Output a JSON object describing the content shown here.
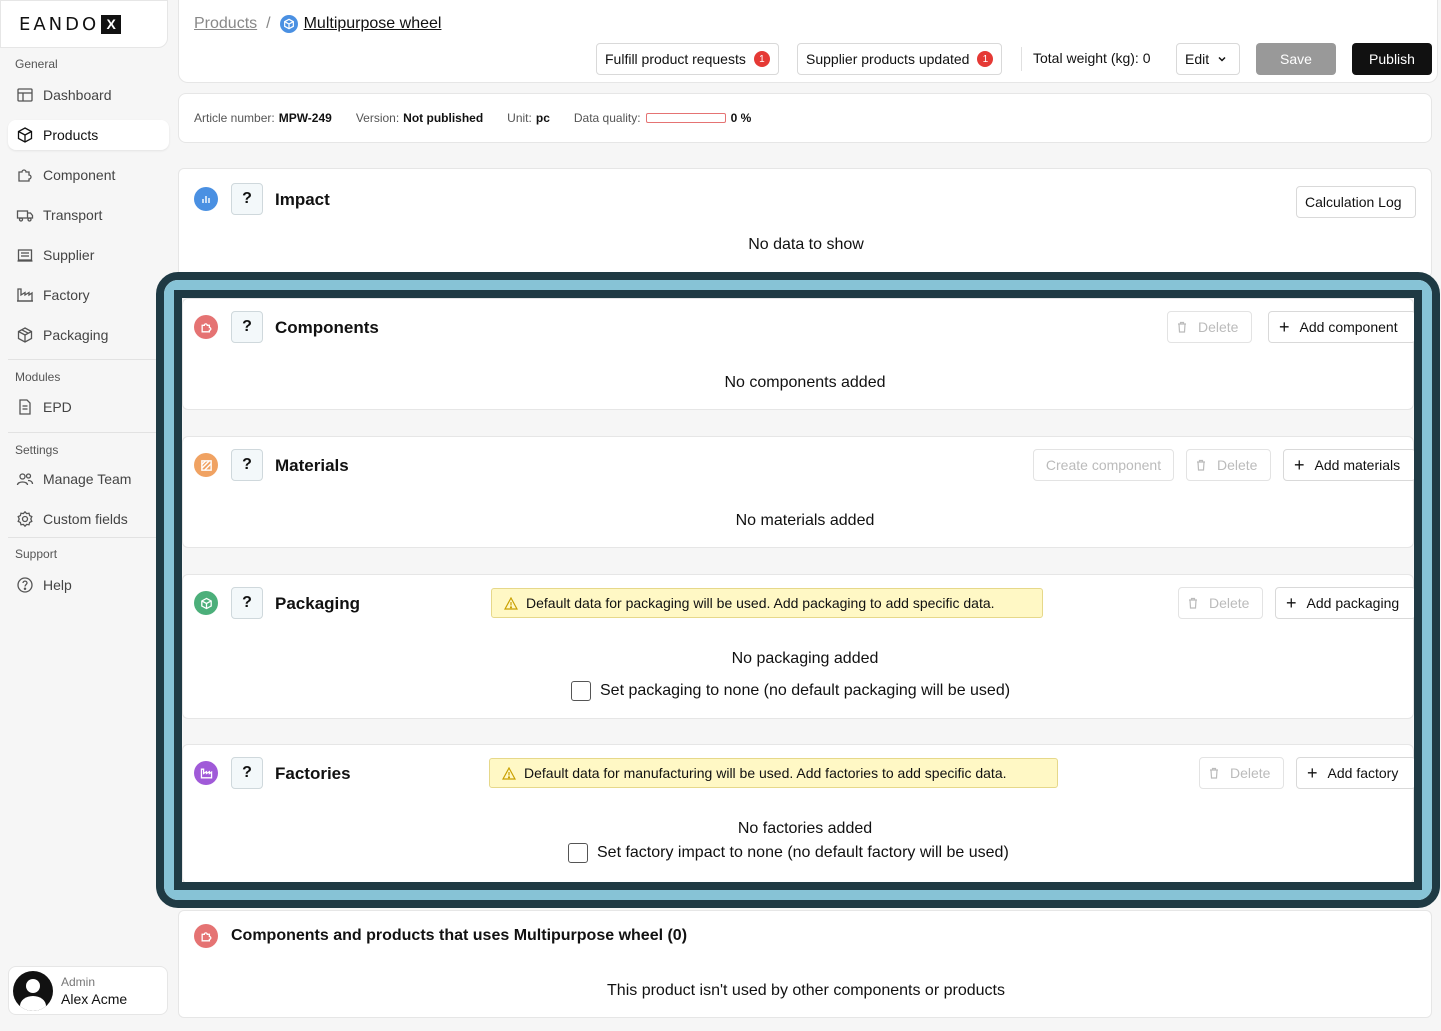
{
  "sidebar": {
    "logo": "EANDO",
    "logo_mark": "X",
    "sections": {
      "general": "General",
      "modules": "Modules",
      "settings": "Settings",
      "support": "Support"
    },
    "items": {
      "dashboard": "Dashboard",
      "products": "Products",
      "component": "Component",
      "transport": "Transport",
      "supplier": "Supplier",
      "factory": "Factory",
      "packaging": "Packaging",
      "epd": "EPD",
      "manage_team": "Manage Team",
      "custom_fields": "Custom fields",
      "help": "Help"
    },
    "user": {
      "role": "Admin",
      "name": "Alex Acme"
    }
  },
  "header": {
    "breadcrumb_root": "Products",
    "breadcrumb_sep": "/",
    "breadcrumb_current": "Multipurpose wheel",
    "fulfill_label": "Fulfill product requests",
    "fulfill_count": "1",
    "supplier_label": "Supplier products updated",
    "supplier_count": "1",
    "weight_label": "Total weight (kg): 0",
    "edit_label": "Edit",
    "save_label": "Save",
    "publish_label": "Publish"
  },
  "info": {
    "article_label": "Article number:",
    "article_value": "MPW-249",
    "version_label": "Version:",
    "version_value": "Not published",
    "unit_label": "Unit:",
    "unit_value": "pc",
    "quality_label": "Data quality:",
    "quality_value": "0 %",
    "quality_fraction": 0
  },
  "impact": {
    "title": "Impact",
    "help": "?",
    "calc_log": "Calculation Log",
    "empty": "No data to show"
  },
  "components": {
    "title": "Components",
    "help": "?",
    "delete": "Delete",
    "add": "Add component",
    "empty": "No components added"
  },
  "materials": {
    "title": "Materials",
    "help": "?",
    "create": "Create component",
    "delete": "Delete",
    "add": "Add materials",
    "empty": "No materials added"
  },
  "packaging": {
    "title": "Packaging",
    "help": "?",
    "warning": "Default data for packaging will be used. Add packaging to add specific data.",
    "delete": "Delete",
    "add": "Add packaging",
    "empty": "No packaging added",
    "checkbox": "Set packaging to none (no default packaging will be used)"
  },
  "factories": {
    "title": "Factories",
    "help": "?",
    "warning": "Default data for manufacturing will be used. Add factories to add specific data.",
    "delete": "Delete",
    "add": "Add factory",
    "empty": "No factories added",
    "checkbox": "Set factory impact to none (no default factory will be used)"
  },
  "usages": {
    "title": "Components and products that uses Multipurpose wheel (0)",
    "empty": "This product isn't used by other components or products"
  },
  "colors": {
    "impact_icon": "#4a90e2",
    "components_icon": "#e57373",
    "materials_icon": "#f0a262",
    "packaging_icon": "#4caf7a",
    "factories_icon": "#a05ad8",
    "highlight_dark": "#1f3a44",
    "highlight_light": "#87c3d6",
    "badge": "#e53935",
    "warning_bg": "#fff8c5"
  }
}
